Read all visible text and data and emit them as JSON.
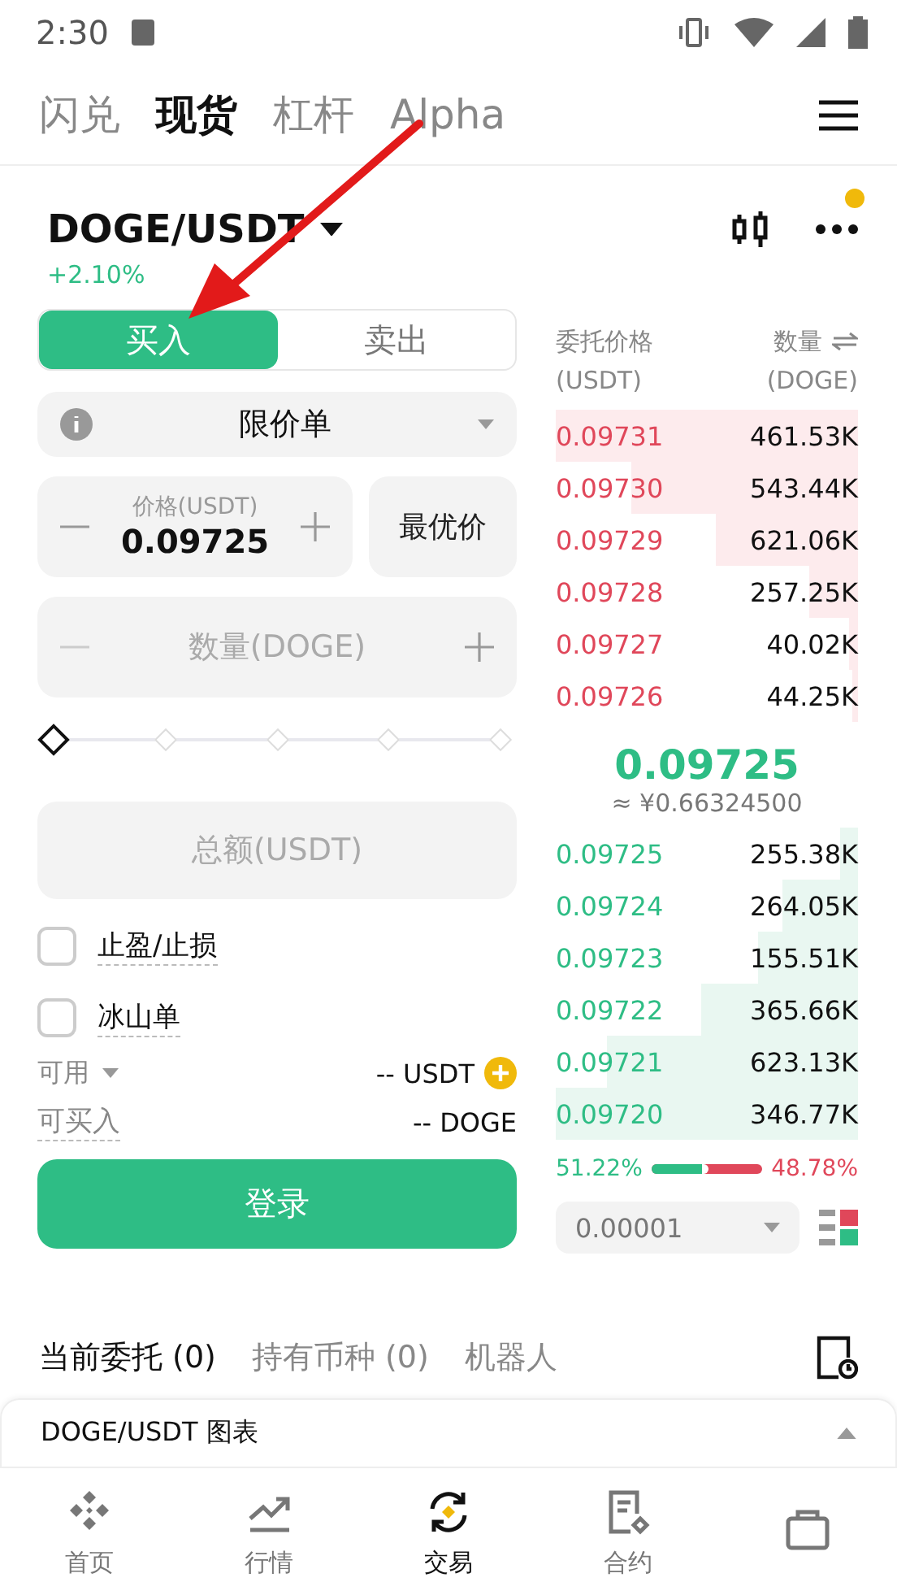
{
  "status_bar": {
    "time": "2:30"
  },
  "top_tabs": [
    {
      "label": "闪兑",
      "selected": false
    },
    {
      "label": "现货",
      "selected": true
    },
    {
      "label": "杠杆",
      "selected": false
    },
    {
      "label": "Alpha",
      "selected": false
    }
  ],
  "pair": {
    "symbol": "DOGE/USDT",
    "change": "+2.10%",
    "notification": true
  },
  "side_tabs": [
    {
      "label": "买入",
      "selected": true
    },
    {
      "label": "卖出",
      "selected": false
    }
  ],
  "order_type": "限价单",
  "price": {
    "label": "价格(USDT)",
    "value": "0.09725",
    "best_button": "最优价"
  },
  "amount": {
    "placeholder": "数量(DOGE)"
  },
  "slider": {
    "level": 0
  },
  "total": {
    "placeholder": "总额(USDT)"
  },
  "options": [
    {
      "label": "止盈/止损",
      "checked": false
    },
    {
      "label": "冰山单",
      "checked": false
    }
  ],
  "available": {
    "label": "可用",
    "value": "-- USDT"
  },
  "can_buy": {
    "label": "可买入",
    "value": "-- DOGE"
  },
  "login_button": "登录",
  "book": {
    "price_header": "委托价格",
    "price_unit": "(USDT)",
    "qty_header": "数量",
    "qty_unit": "(DOGE)",
    "asks": [
      {
        "price": "0.09731",
        "qty": "461.53K"
      },
      {
        "price": "0.09730",
        "qty": "543.44K"
      },
      {
        "price": "0.09729",
        "qty": "621.06K"
      },
      {
        "price": "0.09728",
        "qty": "257.25K"
      },
      {
        "price": "0.09727",
        "qty": "40.02K"
      },
      {
        "price": "0.09726",
        "qty": "44.25K"
      }
    ],
    "last_price": "0.09725",
    "fiat_price": "≈ ¥0.66324500",
    "bids": [
      {
        "price": "0.09725",
        "qty": "255.38K"
      },
      {
        "price": "0.09724",
        "qty": "264.05K"
      },
      {
        "price": "0.09723",
        "qty": "155.51K"
      },
      {
        "price": "0.09722",
        "qty": "365.66K"
      },
      {
        "price": "0.09721",
        "qty": "623.13K"
      },
      {
        "price": "0.09720",
        "qty": "346.77K"
      }
    ],
    "buy_ratio": "51.22%",
    "sell_ratio": "48.78%",
    "ratio": {
      "level": 0.5122
    },
    "precision": "0.00001"
  },
  "order_tabs": [
    {
      "label": "当前委托 (0)",
      "selected": true
    },
    {
      "label": "持有币种 (0)",
      "selected": false
    },
    {
      "label": "机器人",
      "selected": false
    }
  ],
  "chart_bar": {
    "label": "DOGE/USDT 图表"
  },
  "nav": [
    {
      "label": "首页",
      "selected": false
    },
    {
      "label": "行情",
      "selected": false
    },
    {
      "label": "交易",
      "selected": true
    },
    {
      "label": "合约",
      "selected": false
    },
    {
      "selected": false
    }
  ]
}
